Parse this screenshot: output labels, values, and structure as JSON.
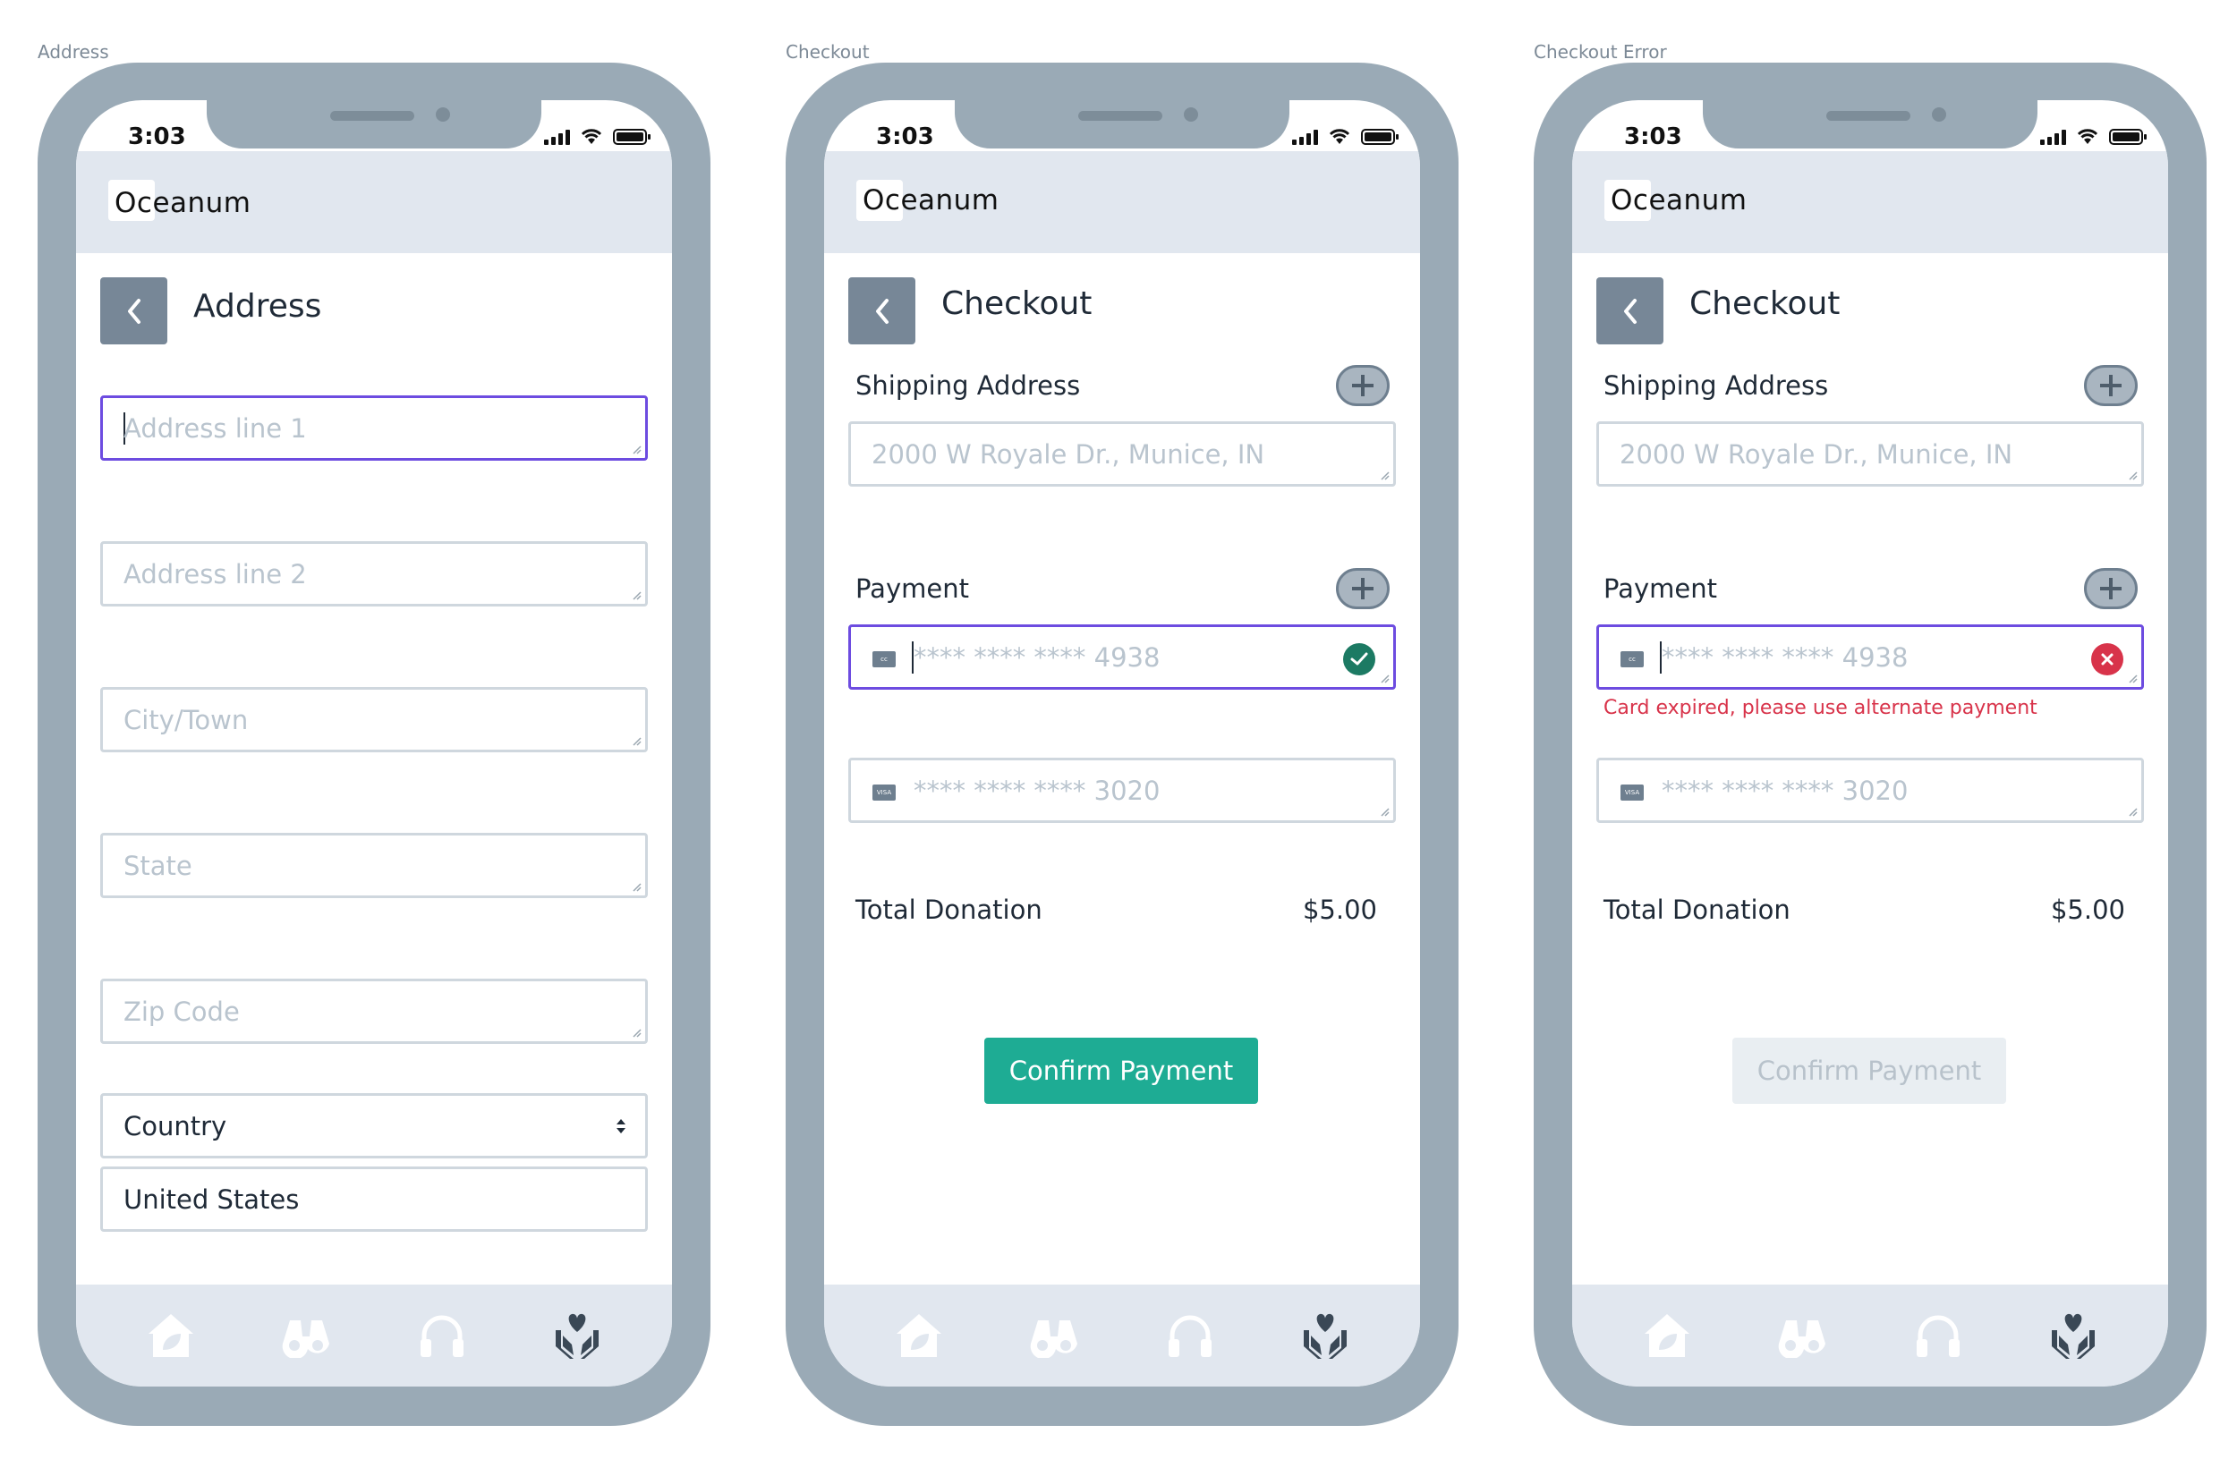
{
  "status": {
    "time": "3:03"
  },
  "app": {
    "name": "Oceanum"
  },
  "screens": [
    {
      "label": "Address",
      "title": "Address",
      "fields": {
        "address1_placeholder": "Address line 1",
        "address2_placeholder": "Address line 2",
        "city_placeholder": "City/Town",
        "state_placeholder": "State",
        "zip_placeholder": "Zip Code",
        "country_select": "Country",
        "country_value": "United States"
      }
    },
    {
      "label": "Checkout",
      "title": "Checkout",
      "shipping_label": "Shipping Address",
      "shipping_placeholder": "2000 W Royale Dr., Munice, IN",
      "payment_label": "Payment",
      "card1": {
        "brand": "cc",
        "number": "****  ****  ****  4938",
        "status": "valid"
      },
      "card2": {
        "brand": "VISA",
        "number": "****  ****  ****  3020"
      },
      "total_label": "Total Donation",
      "total_value": "$5.00",
      "confirm_label": "Confirm Payment"
    },
    {
      "label": "Checkout Error",
      "title": "Checkout",
      "shipping_label": "Shipping Address",
      "shipping_placeholder": "2000 W Royale Dr., Munice, IN",
      "payment_label": "Payment",
      "card1": {
        "brand": "cc",
        "number": "****  ****  ****  4938",
        "status": "error"
      },
      "error_message": "Card expired, please use alternate payment",
      "card2": {
        "brand": "VISA",
        "number": "****  ****  ****  3020"
      },
      "total_label": "Total Donation",
      "total_value": "$5.00",
      "confirm_label": "Confirm Payment"
    }
  ],
  "tabbar": {
    "icons": [
      "home-leaf-icon",
      "binoculars-icon",
      "headphones-icon",
      "heart-hands-icon"
    ],
    "active": "heart-hands-icon"
  },
  "colors": {
    "device": "#9aaab6",
    "header": "#e1e7ef",
    "focus_border": "#6d4ce0",
    "success": "#1c7a63",
    "error": "#d8334a",
    "confirm": "#1eac94"
  }
}
